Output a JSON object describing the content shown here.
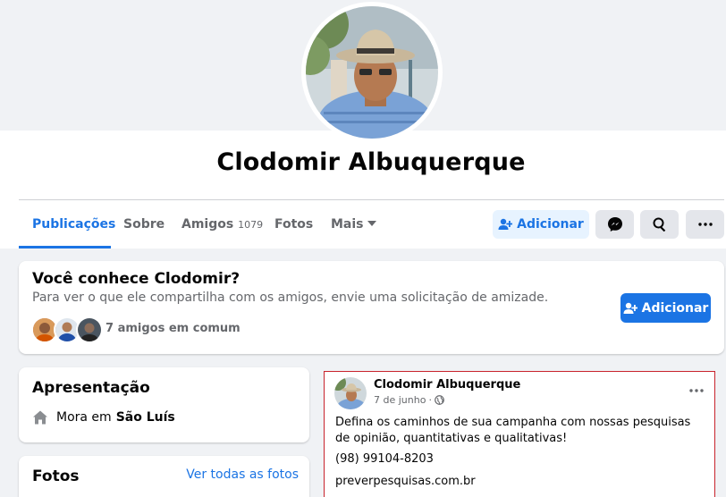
{
  "profile": {
    "name": "Clodomir Albuquerque"
  },
  "tabs": [
    {
      "label": "Publicações"
    },
    {
      "label": "Sobre"
    },
    {
      "label": "Amigos",
      "count": "1079"
    },
    {
      "label": "Fotos"
    },
    {
      "label": "Mais"
    }
  ],
  "actions": {
    "add_label": "Adicionar"
  },
  "know_card": {
    "title": "Você conhece Clodomir?",
    "subtitle": "Para ver o que ele compartilha com os amigos, envie uma solicitação de amizade.",
    "mutual": "7 amigos em comum",
    "add_label": "Adicionar"
  },
  "intro": {
    "title": "Apresentação",
    "lives_prefix": "Mora em",
    "city": "São Luís"
  },
  "photos": {
    "title": "Fotos",
    "see_all": "Ver todas as fotos"
  },
  "post": {
    "author": "Clodomir Albuquerque",
    "date": "7 de junho",
    "text": "Defina os caminhos de sua campanha com nossas pesquisas de opinião, quantitativas e qualitativas!",
    "phone": "(98) 99104-8203",
    "url": "preverpesquisas.com.br"
  },
  "colors": {
    "brand": "#1b74e4",
    "background": "#f0f2f5",
    "highlight_border": "#c8232c"
  }
}
